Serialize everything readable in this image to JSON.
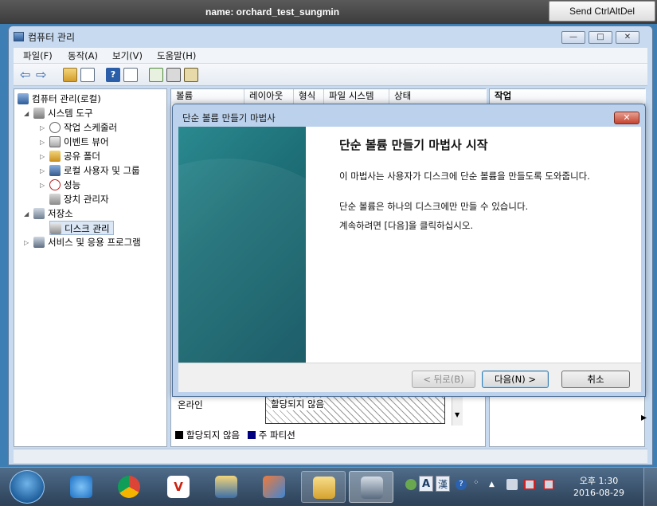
{
  "vnc": {
    "title": "name: orchard_test_sungmin",
    "send_button": "Send CtrlAltDel"
  },
  "window": {
    "title": "컴퓨터 관리",
    "minimize": "—",
    "maximize": "□",
    "close": "✕"
  },
  "menu": [
    "파일(F)",
    "동작(A)",
    "보기(V)",
    "도움말(H)"
  ],
  "tree": {
    "root": "컴퓨터 관리(로컬)",
    "system_tools": "시스템 도구",
    "task_scheduler": "작업 스케줄러",
    "event_viewer": "이벤트 뷰어",
    "shared_folders": "공유 폴더",
    "local_users": "로컬 사용자 및 그룹",
    "performance": "성능",
    "device_manager": "장치 관리자",
    "storage": "저장소",
    "disk_management": "디스크 관리",
    "services": "서비스 및 응용 프로그램"
  },
  "columns": [
    "볼륨",
    "레이아웃",
    "형식",
    "파일 시스템",
    "상태"
  ],
  "actions_header": "작업",
  "disk": {
    "status": "온라인",
    "unallocated": "할당되지 않음"
  },
  "legend": {
    "unallocated": "할당되지 않음",
    "primary": "주 파티션",
    "colors": {
      "unallocated": "#000000",
      "primary": "#000080"
    }
  },
  "dialog": {
    "title": "단순 볼륨 만들기 마법사",
    "heading": "단순 볼륨 만들기 마법사 시작",
    "para1": "이 마법사는 사용자가 디스크에 단순 볼륨을 만들도록 도와줍니다.",
    "para2": "단순 볼륨은 하나의 디스크에만 만들 수 있습니다.",
    "para3": "계속하려면 [다음]을 클릭하십시오.",
    "back_button": "< 뒤로(B)",
    "next_button": "다음(N) >",
    "cancel_button": "취소"
  },
  "taskbar": {
    "clock_time": "오후 1:30",
    "clock_date": "2016-08-29",
    "ime_a": "A",
    "ime_han": "漢"
  }
}
